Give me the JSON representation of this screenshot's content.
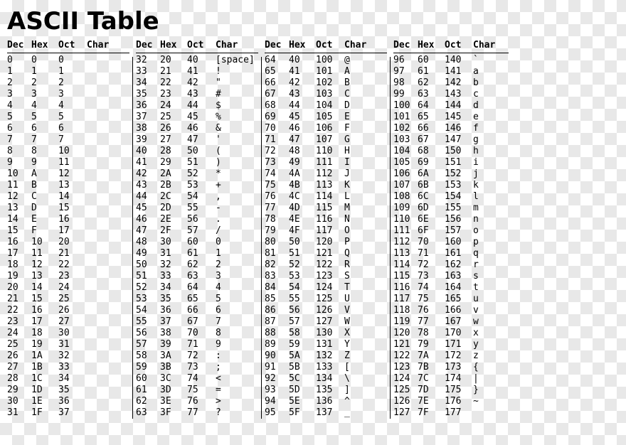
{
  "title": "ASCII Table",
  "headers": {
    "dec": "Dec",
    "hex": "Hex",
    "oct": "Oct",
    "char": "Char"
  },
  "panels": [
    {
      "rows": [
        {
          "dec": "0",
          "hex": "0",
          "oct": "0",
          "char": ""
        },
        {
          "dec": "1",
          "hex": "1",
          "oct": "1",
          "char": ""
        },
        {
          "dec": "2",
          "hex": "2",
          "oct": "2",
          "char": ""
        },
        {
          "dec": "3",
          "hex": "3",
          "oct": "3",
          "char": ""
        },
        {
          "dec": "4",
          "hex": "4",
          "oct": "4",
          "char": ""
        },
        {
          "dec": "5",
          "hex": "5",
          "oct": "5",
          "char": ""
        },
        {
          "dec": "6",
          "hex": "6",
          "oct": "6",
          "char": ""
        },
        {
          "dec": "7",
          "hex": "7",
          "oct": "7",
          "char": ""
        },
        {
          "dec": "8",
          "hex": "8",
          "oct": "10",
          "char": ""
        },
        {
          "dec": "9",
          "hex": "9",
          "oct": "11",
          "char": ""
        },
        {
          "dec": "10",
          "hex": "A",
          "oct": "12",
          "char": ""
        },
        {
          "dec": "11",
          "hex": "B",
          "oct": "13",
          "char": ""
        },
        {
          "dec": "12",
          "hex": "C",
          "oct": "14",
          "char": ""
        },
        {
          "dec": "13",
          "hex": "D",
          "oct": "15",
          "char": ""
        },
        {
          "dec": "14",
          "hex": "E",
          "oct": "16",
          "char": ""
        },
        {
          "dec": "15",
          "hex": "F",
          "oct": "17",
          "char": ""
        },
        {
          "dec": "16",
          "hex": "10",
          "oct": "20",
          "char": ""
        },
        {
          "dec": "17",
          "hex": "11",
          "oct": "21",
          "char": ""
        },
        {
          "dec": "18",
          "hex": "12",
          "oct": "22",
          "char": ""
        },
        {
          "dec": "19",
          "hex": "13",
          "oct": "23",
          "char": ""
        },
        {
          "dec": "20",
          "hex": "14",
          "oct": "24",
          "char": ""
        },
        {
          "dec": "21",
          "hex": "15",
          "oct": "25",
          "char": ""
        },
        {
          "dec": "22",
          "hex": "16",
          "oct": "26",
          "char": ""
        },
        {
          "dec": "23",
          "hex": "17",
          "oct": "27",
          "char": ""
        },
        {
          "dec": "24",
          "hex": "18",
          "oct": "30",
          "char": ""
        },
        {
          "dec": "25",
          "hex": "19",
          "oct": "31",
          "char": ""
        },
        {
          "dec": "26",
          "hex": "1A",
          "oct": "32",
          "char": ""
        },
        {
          "dec": "27",
          "hex": "1B",
          "oct": "33",
          "char": ""
        },
        {
          "dec": "28",
          "hex": "1C",
          "oct": "34",
          "char": ""
        },
        {
          "dec": "29",
          "hex": "1D",
          "oct": "35",
          "char": ""
        },
        {
          "dec": "30",
          "hex": "1E",
          "oct": "36",
          "char": ""
        },
        {
          "dec": "31",
          "hex": "1F",
          "oct": "37",
          "char": ""
        }
      ]
    },
    {
      "rows": [
        {
          "dec": "32",
          "hex": "20",
          "oct": "40",
          "char": "[space]"
        },
        {
          "dec": "33",
          "hex": "21",
          "oct": "41",
          "char": "!"
        },
        {
          "dec": "34",
          "hex": "22",
          "oct": "42",
          "char": "\""
        },
        {
          "dec": "35",
          "hex": "23",
          "oct": "43",
          "char": "#"
        },
        {
          "dec": "36",
          "hex": "24",
          "oct": "44",
          "char": "$"
        },
        {
          "dec": "37",
          "hex": "25",
          "oct": "45",
          "char": "%"
        },
        {
          "dec": "38",
          "hex": "26",
          "oct": "46",
          "char": "&"
        },
        {
          "dec": "39",
          "hex": "27",
          "oct": "47",
          "char": "'"
        },
        {
          "dec": "40",
          "hex": "28",
          "oct": "50",
          "char": "("
        },
        {
          "dec": "41",
          "hex": "29",
          "oct": "51",
          "char": ")"
        },
        {
          "dec": "42",
          "hex": "2A",
          "oct": "52",
          "char": "*"
        },
        {
          "dec": "43",
          "hex": "2B",
          "oct": "53",
          "char": "+"
        },
        {
          "dec": "44",
          "hex": "2C",
          "oct": "54",
          "char": ","
        },
        {
          "dec": "45",
          "hex": "2D",
          "oct": "55",
          "char": "-"
        },
        {
          "dec": "46",
          "hex": "2E",
          "oct": "56",
          "char": "."
        },
        {
          "dec": "47",
          "hex": "2F",
          "oct": "57",
          "char": "/"
        },
        {
          "dec": "48",
          "hex": "30",
          "oct": "60",
          "char": "0"
        },
        {
          "dec": "49",
          "hex": "31",
          "oct": "61",
          "char": "1"
        },
        {
          "dec": "50",
          "hex": "32",
          "oct": "62",
          "char": "2"
        },
        {
          "dec": "51",
          "hex": "33",
          "oct": "63",
          "char": "3"
        },
        {
          "dec": "52",
          "hex": "34",
          "oct": "64",
          "char": "4"
        },
        {
          "dec": "53",
          "hex": "35",
          "oct": "65",
          "char": "5"
        },
        {
          "dec": "54",
          "hex": "36",
          "oct": "66",
          "char": "6"
        },
        {
          "dec": "55",
          "hex": "37",
          "oct": "67",
          "char": "7"
        },
        {
          "dec": "56",
          "hex": "38",
          "oct": "70",
          "char": "8"
        },
        {
          "dec": "57",
          "hex": "39",
          "oct": "71",
          "char": "9"
        },
        {
          "dec": "58",
          "hex": "3A",
          "oct": "72",
          "char": ":"
        },
        {
          "dec": "59",
          "hex": "3B",
          "oct": "73",
          "char": ";"
        },
        {
          "dec": "60",
          "hex": "3C",
          "oct": "74",
          "char": "<"
        },
        {
          "dec": "61",
          "hex": "3D",
          "oct": "75",
          "char": "="
        },
        {
          "dec": "62",
          "hex": "3E",
          "oct": "76",
          "char": ">"
        },
        {
          "dec": "63",
          "hex": "3F",
          "oct": "77",
          "char": "?"
        }
      ]
    },
    {
      "rows": [
        {
          "dec": "64",
          "hex": "40",
          "oct": "100",
          "char": "@"
        },
        {
          "dec": "65",
          "hex": "41",
          "oct": "101",
          "char": "A"
        },
        {
          "dec": "66",
          "hex": "42",
          "oct": "102",
          "char": "B"
        },
        {
          "dec": "67",
          "hex": "43",
          "oct": "103",
          "char": "C"
        },
        {
          "dec": "68",
          "hex": "44",
          "oct": "104",
          "char": "D"
        },
        {
          "dec": "69",
          "hex": "45",
          "oct": "105",
          "char": "E"
        },
        {
          "dec": "70",
          "hex": "46",
          "oct": "106",
          "char": "F"
        },
        {
          "dec": "71",
          "hex": "47",
          "oct": "107",
          "char": "G"
        },
        {
          "dec": "72",
          "hex": "48",
          "oct": "110",
          "char": "H"
        },
        {
          "dec": "73",
          "hex": "49",
          "oct": "111",
          "char": "I"
        },
        {
          "dec": "74",
          "hex": "4A",
          "oct": "112",
          "char": "J"
        },
        {
          "dec": "75",
          "hex": "4B",
          "oct": "113",
          "char": "K"
        },
        {
          "dec": "76",
          "hex": "4C",
          "oct": "114",
          "char": "L"
        },
        {
          "dec": "77",
          "hex": "4D",
          "oct": "115",
          "char": "M"
        },
        {
          "dec": "78",
          "hex": "4E",
          "oct": "116",
          "char": "N"
        },
        {
          "dec": "79",
          "hex": "4F",
          "oct": "117",
          "char": "O"
        },
        {
          "dec": "80",
          "hex": "50",
          "oct": "120",
          "char": "P"
        },
        {
          "dec": "81",
          "hex": "51",
          "oct": "121",
          "char": "Q"
        },
        {
          "dec": "82",
          "hex": "52",
          "oct": "122",
          "char": "R"
        },
        {
          "dec": "83",
          "hex": "53",
          "oct": "123",
          "char": "S"
        },
        {
          "dec": "84",
          "hex": "54",
          "oct": "124",
          "char": "T"
        },
        {
          "dec": "85",
          "hex": "55",
          "oct": "125",
          "char": "U"
        },
        {
          "dec": "86",
          "hex": "56",
          "oct": "126",
          "char": "V"
        },
        {
          "dec": "87",
          "hex": "57",
          "oct": "127",
          "char": "W"
        },
        {
          "dec": "88",
          "hex": "58",
          "oct": "130",
          "char": "X"
        },
        {
          "dec": "89",
          "hex": "59",
          "oct": "131",
          "char": "Y"
        },
        {
          "dec": "90",
          "hex": "5A",
          "oct": "132",
          "char": "Z"
        },
        {
          "dec": "91",
          "hex": "5B",
          "oct": "133",
          "char": "["
        },
        {
          "dec": "92",
          "hex": "5C",
          "oct": "134",
          "char": "\\"
        },
        {
          "dec": "93",
          "hex": "5D",
          "oct": "135",
          "char": "]"
        },
        {
          "dec": "94",
          "hex": "5E",
          "oct": "136",
          "char": "^"
        },
        {
          "dec": "95",
          "hex": "5F",
          "oct": "137",
          "char": "_"
        }
      ]
    },
    {
      "rows": [
        {
          "dec": "96",
          "hex": "60",
          "oct": "140",
          "char": "`"
        },
        {
          "dec": "97",
          "hex": "61",
          "oct": "141",
          "char": "a"
        },
        {
          "dec": "98",
          "hex": "62",
          "oct": "142",
          "char": "b"
        },
        {
          "dec": "99",
          "hex": "63",
          "oct": "143",
          "char": "c"
        },
        {
          "dec": "100",
          "hex": "64",
          "oct": "144",
          "char": "d"
        },
        {
          "dec": "101",
          "hex": "65",
          "oct": "145",
          "char": "e"
        },
        {
          "dec": "102",
          "hex": "66",
          "oct": "146",
          "char": "f"
        },
        {
          "dec": "103",
          "hex": "67",
          "oct": "147",
          "char": "g"
        },
        {
          "dec": "104",
          "hex": "68",
          "oct": "150",
          "char": "h"
        },
        {
          "dec": "105",
          "hex": "69",
          "oct": "151",
          "char": "i"
        },
        {
          "dec": "106",
          "hex": "6A",
          "oct": "152",
          "char": "j"
        },
        {
          "dec": "107",
          "hex": "6B",
          "oct": "153",
          "char": "k"
        },
        {
          "dec": "108",
          "hex": "6C",
          "oct": "154",
          "char": "l"
        },
        {
          "dec": "109",
          "hex": "6D",
          "oct": "155",
          "char": "m"
        },
        {
          "dec": "110",
          "hex": "6E",
          "oct": "156",
          "char": "n"
        },
        {
          "dec": "111",
          "hex": "6F",
          "oct": "157",
          "char": "o"
        },
        {
          "dec": "112",
          "hex": "70",
          "oct": "160",
          "char": "p"
        },
        {
          "dec": "113",
          "hex": "71",
          "oct": "161",
          "char": "q"
        },
        {
          "dec": "114",
          "hex": "72",
          "oct": "162",
          "char": "r"
        },
        {
          "dec": "115",
          "hex": "73",
          "oct": "163",
          "char": "s"
        },
        {
          "dec": "116",
          "hex": "74",
          "oct": "164",
          "char": "t"
        },
        {
          "dec": "117",
          "hex": "75",
          "oct": "165",
          "char": "u"
        },
        {
          "dec": "118",
          "hex": "76",
          "oct": "166",
          "char": "v"
        },
        {
          "dec": "119",
          "hex": "77",
          "oct": "167",
          "char": "w"
        },
        {
          "dec": "120",
          "hex": "78",
          "oct": "170",
          "char": "x"
        },
        {
          "dec": "121",
          "hex": "79",
          "oct": "171",
          "char": "y"
        },
        {
          "dec": "122",
          "hex": "7A",
          "oct": "172",
          "char": "z"
        },
        {
          "dec": "123",
          "hex": "7B",
          "oct": "173",
          "char": "{"
        },
        {
          "dec": "124",
          "hex": "7C",
          "oct": "174",
          "char": "|"
        },
        {
          "dec": "125",
          "hex": "7D",
          "oct": "175",
          "char": "}"
        },
        {
          "dec": "126",
          "hex": "7E",
          "oct": "176",
          "char": "~"
        },
        {
          "dec": "127",
          "hex": "7F",
          "oct": "177",
          "char": ""
        }
      ]
    }
  ]
}
